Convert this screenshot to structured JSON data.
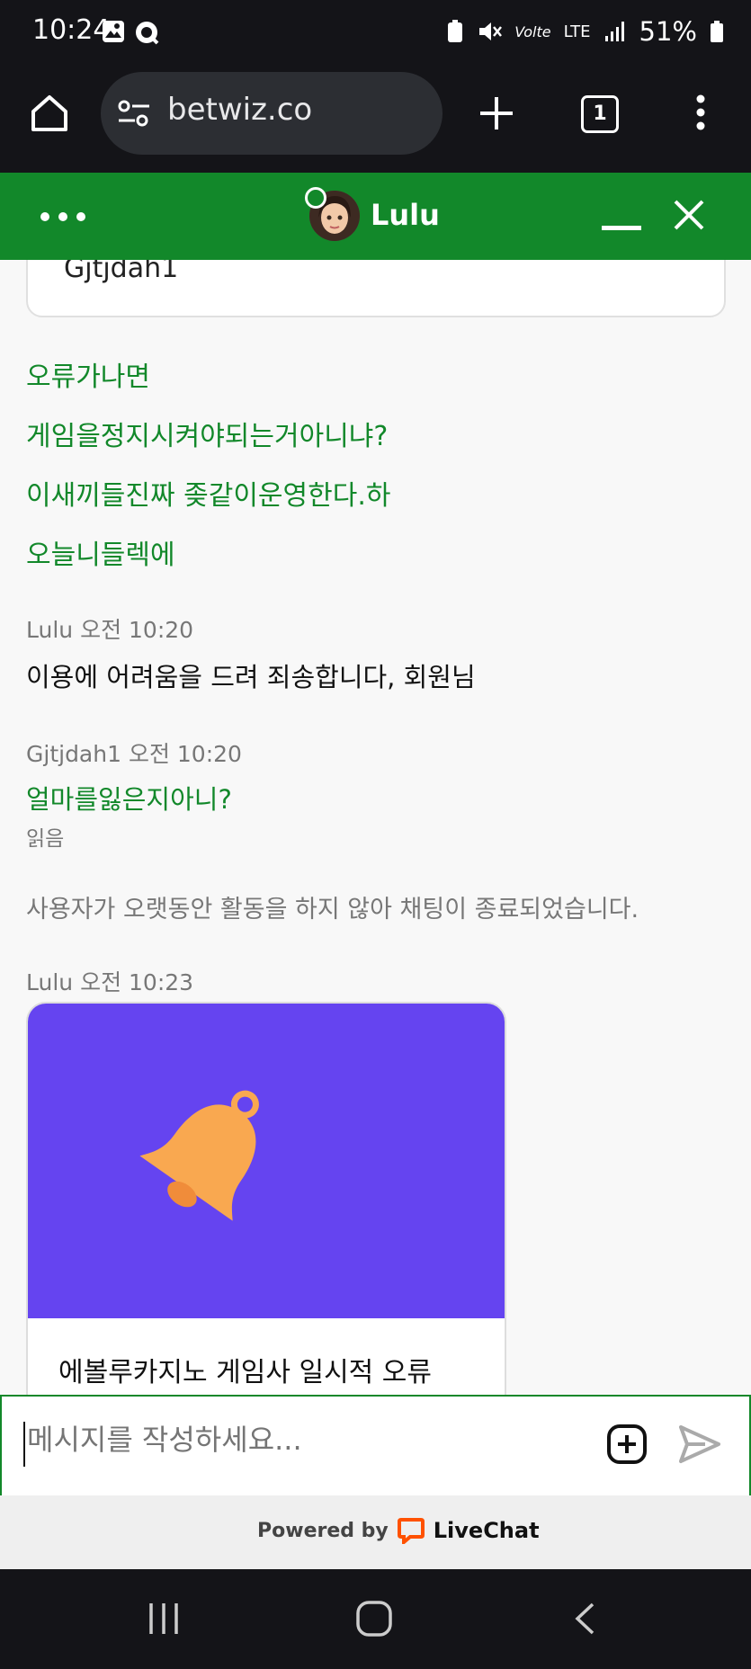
{
  "status_bar": {
    "time": "10:24",
    "volte_label": "Volte",
    "network": "LTE",
    "battery": "51%"
  },
  "browser": {
    "url": "betwiz.co",
    "tab_count": "1"
  },
  "chat_header": {
    "agent_name": "Lulu"
  },
  "messages": {
    "previous_card_text": "Gjtjdah1",
    "user_lines": [
      "오류가나면",
      "게임을정지시켜야되는거아니냐?",
      "이새끼들진짜 좆같이운영한다.하",
      "오늘니들렉에"
    ],
    "agent_meta_1": "Lulu 오전 10:20",
    "agent_text_1": "이용에 어려움을 드려 죄송합니다, 회원님",
    "user_meta_2": "Gjtjdah1 오전 10:20",
    "user_text_2": "얼마를잃은지아니?",
    "read_status": "읽음",
    "system_notice": "사용자가 오랫동안 활동을 하지 않아 채팅이 종료되었습니다.",
    "agent_meta_2": "Lulu 오전 10:23",
    "card_title": "에볼루카지노 게임사 일시적 오류"
  },
  "composer": {
    "placeholder": "메시지를 작성하세요..."
  },
  "footer": {
    "powered_by": "Powered by",
    "brand": "LiveChat"
  },
  "colors": {
    "accent_green": "#12882a",
    "card_purple": "#6544f0",
    "bell_orange": "#f9a850",
    "livechat_orange": "#ff5100"
  }
}
